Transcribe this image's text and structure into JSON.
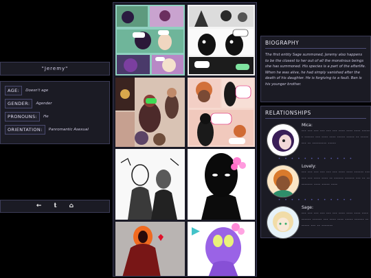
{
  "profile": {
    "name": "\"Jeremy\"",
    "fields": [
      {
        "label": "AGE:",
        "value": "Doesn't age"
      },
      {
        "label": "GENDER:",
        "value": "Agender"
      },
      {
        "label": "PRONOUNS:",
        "value": "He"
      },
      {
        "label": "ORIENTATION:",
        "value": "Panromantic Asexual"
      }
    ]
  },
  "nav": {
    "back": "←",
    "tumblr": "t",
    "home": "⌂"
  },
  "biography": {
    "title": "BIOGRAPHY",
    "text": "The first entity Sage summoned, Jeremy also happens to be the closest to her out of all the monstrous beings she has summoned. His species is a part of the afterlife. When he was alive, he had simply vanished after the death of his daughter. He is forgiving to a fault. Ben is his younger brother."
  },
  "relationships": {
    "title": "RELATIONSHIPS",
    "items": [
      {
        "name": "Mica:",
        "desc": "--- --- --- --- --- --- ---- ---- ---- ------ ------ --- ---- ---- ----- ----- -- ----- --- -- --------- -----"
      },
      {
        "name": "Lovely:",
        "desc": "--- --- --- --- --- --- ---- ---- ------ ------ --- ---- ---- -- ------ ------ --- -- --------- ---- ----- ----"
      },
      {
        "name": "Sage:",
        "desc": "--- --- --- --- --- --- ---- ---- ---- ---- ------ ------ --- ---- ---- ----- ------ -- ----- --- -- -------"
      }
    ],
    "separator": "• • • • • • • • • • • •"
  },
  "colors": {
    "background": "#000000",
    "panel": "#1b1b24",
    "border": "#3c3c58",
    "accent": "#5a5aaa"
  }
}
